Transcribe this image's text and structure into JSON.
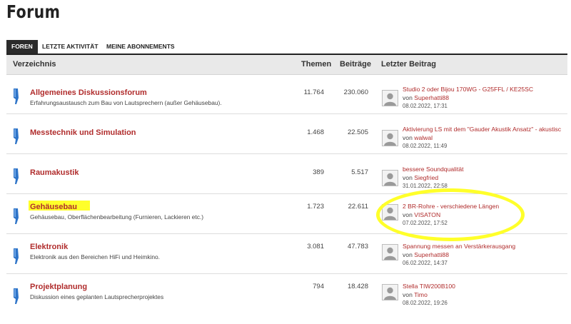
{
  "page": {
    "title": "Forum"
  },
  "tabs": [
    {
      "label": "FOREN",
      "active": true
    },
    {
      "label": "LETZTE AKTIVITÄT",
      "active": false
    },
    {
      "label": "MEINE ABONNEMENTS",
      "active": false
    }
  ],
  "table": {
    "headers": {
      "directory": "Verzeichnis",
      "topics": "Themen",
      "posts": "Beiträge",
      "last_post": "Letzter Beitrag"
    }
  },
  "forums": [
    {
      "title": "Allgemeines Diskussionsforum",
      "description": "Erfahrungsaustausch zum Bau von Lautsprechern (außer Gehäusebau).",
      "topics": "11.764",
      "posts": "230.060",
      "last_post": {
        "title": "Studio 2 oder Bijou 170WG - G25FFL / KE25SC",
        "by": "von",
        "user": "Superhatti88",
        "date": "08.02.2022, 17:31"
      }
    },
    {
      "title": "Messtechnik und Simulation",
      "description": "",
      "topics": "1.468",
      "posts": "22.505",
      "last_post": {
        "title": "Aktivierung LS mit dem \"Gauder Akustik Ansatz\" - akustisc",
        "by": "von",
        "user": "walwal",
        "date": "08.02.2022, 11:49"
      }
    },
    {
      "title": "Raumakustik",
      "description": "",
      "topics": "389",
      "posts": "5.517",
      "last_post": {
        "title": "bessere Soundqualität",
        "by": "von",
        "user": "Siegfried",
        "date": "31.01.2022, 22:58"
      }
    },
    {
      "title": "Gehäusebau",
      "description": "Gehäusebau, Oberflächenbearbeitung (Furnieren, Lackieren etc.)",
      "topics": "1.723",
      "posts": "22.611",
      "last_post": {
        "title": "2 BR-Rohre - verschiedene Längen",
        "by": "von",
        "user": "VISATON",
        "date": "07.02.2022, 17:52"
      }
    },
    {
      "title": "Elektronik",
      "description": "Elektronik aus den Bereichen HiFi und Heimkino.",
      "topics": "3.081",
      "posts": "47.783",
      "last_post": {
        "title": "Spannung messen an Verstärkerausgang",
        "by": "von",
        "user": "Superhatti88",
        "date": "06.02.2022, 14:37"
      }
    },
    {
      "title": "Projektplanung",
      "description": "Diskussion eines geplanten Lautsprecherprojektes",
      "topics": "794",
      "posts": "18.428",
      "last_post": {
        "title": "Stella TIW200B100",
        "by": "von",
        "user": "Timo",
        "date": "08.02.2022, 19:26"
      }
    }
  ],
  "colors": {
    "link": "#b02c2c",
    "tab_active_bg": "#2b2b2b",
    "header_bg": "#e9e9e9",
    "icon": "#2e74c8",
    "highlight": "#ffff2a"
  }
}
